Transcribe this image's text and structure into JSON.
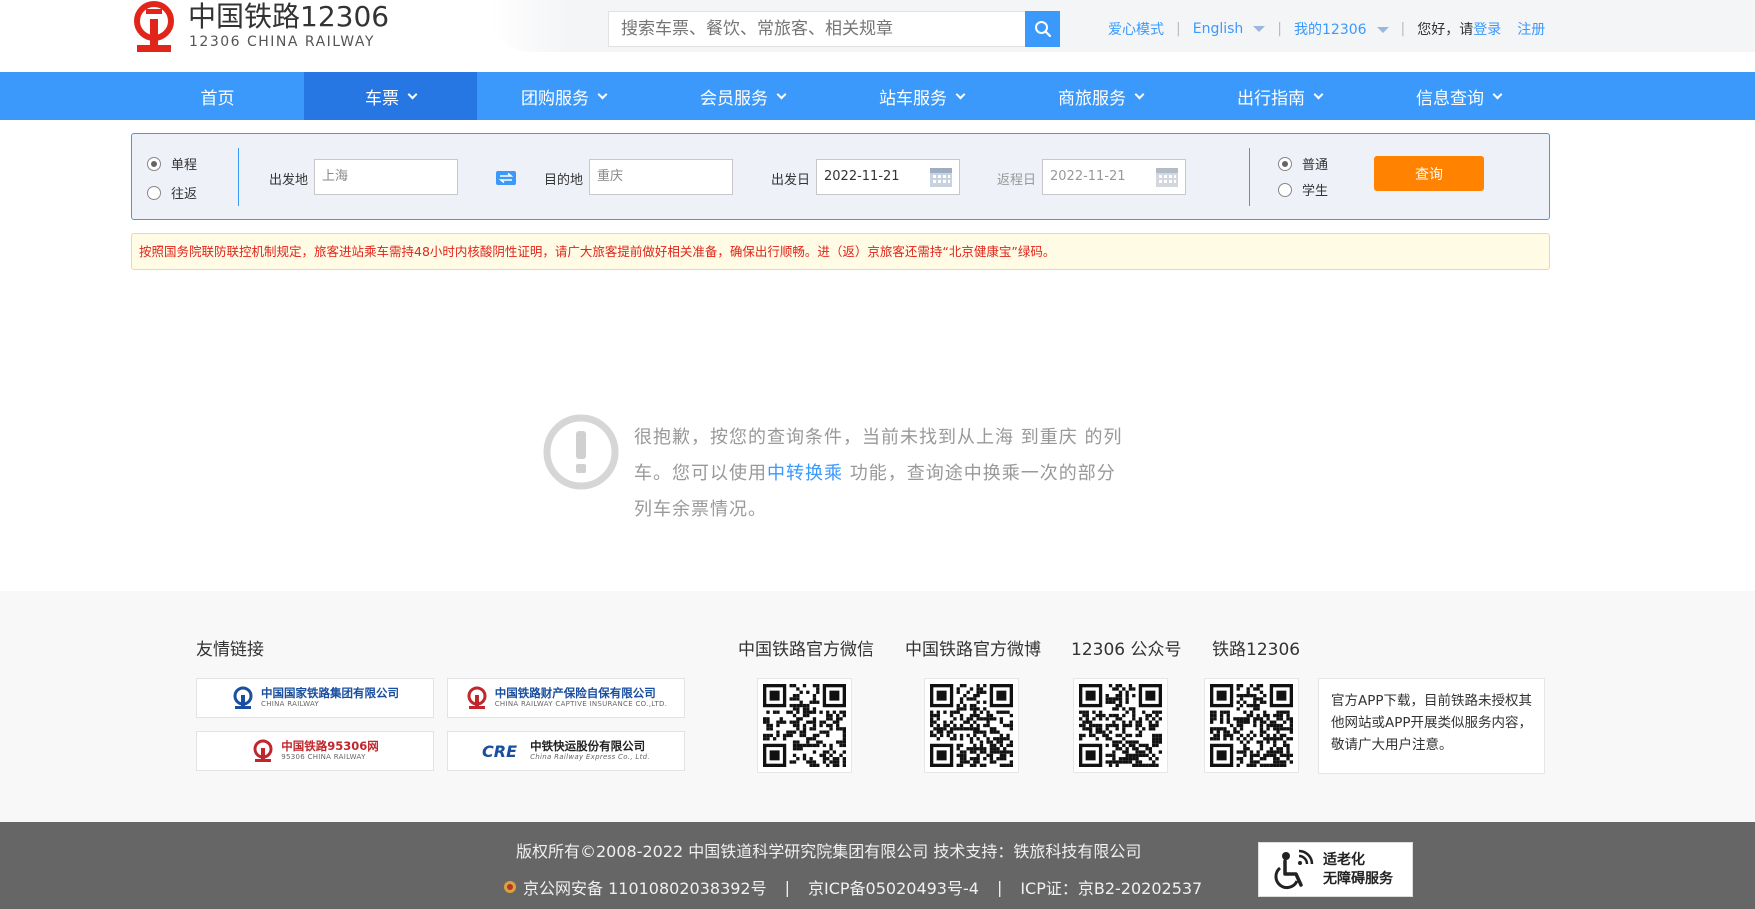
{
  "header": {
    "logo_cn": "中国铁路12306",
    "logo_en": "12306 CHINA RAILWAY",
    "search_placeholder": "搜索车票、餐饮、常旅客、相关规章",
    "links": {
      "care_mode": "爱心模式",
      "english": "English",
      "my12306": "我的12306",
      "greeting": "您好，请",
      "login": "登录",
      "register": "注册"
    }
  },
  "nav": {
    "items": [
      {
        "label": "首页",
        "dropdown": false,
        "active": false
      },
      {
        "label": "车票",
        "dropdown": true,
        "active": true
      },
      {
        "label": "团购服务",
        "dropdown": true,
        "active": false
      },
      {
        "label": "会员服务",
        "dropdown": true,
        "active": false
      },
      {
        "label": "站车服务",
        "dropdown": true,
        "active": false
      },
      {
        "label": "商旅服务",
        "dropdown": true,
        "active": false
      },
      {
        "label": "出行指南",
        "dropdown": true,
        "active": false
      },
      {
        "label": "信息查询",
        "dropdown": true,
        "active": false
      }
    ]
  },
  "query": {
    "trip_type": {
      "one_way": "单程",
      "round_trip": "往返",
      "selected": "one_way"
    },
    "from_label": "出发地",
    "from_value": "上海",
    "to_label": "目的地",
    "to_value": "重庆",
    "depart_label": "出发日",
    "depart_value": "2022-11-21",
    "return_label": "返程日",
    "return_value": "2022-11-21",
    "passenger": {
      "normal": "普通",
      "student": "学生",
      "selected": "normal"
    },
    "search_button": "查询"
  },
  "notice": "按照国务院联防联控机制规定，旅客进站乘车需持48小时内核酸阴性证明，请广大旅客提前做好相关准备，确保出行顺畅。进（返）京旅客还需持“北京健康宝”绿码。",
  "empty": {
    "line1": "很抱歉，按您的查询条件，当前未找到从上海 到重庆 的列",
    "line2_pre": "车。您可以使用",
    "line2_link": "中转换乘",
    "line2_post": " 功能，查询途中换乘一次的部分",
    "line3": "列车余票情况。"
  },
  "footer": {
    "friend_links_title": "友情链接",
    "friend_links": [
      {
        "main": "中国国家铁路集团有限公司",
        "sub": "CHINA RAILWAY"
      },
      {
        "main": "中国铁路财产保险自保有限公司",
        "sub": "CHINA RAILWAY CAPTIVE INSURANCE CO.,LTD."
      },
      {
        "main": "中国铁路95306网",
        "sub": "95306 CHINA RAILWAY"
      },
      {
        "main": "中铁快运股份有限公司",
        "sub": "China Railway Express Co., Ltd."
      }
    ],
    "qr_titles": [
      "中国铁路官方微信",
      "中国铁路官方微博",
      "12306 公众号",
      "铁路12306"
    ],
    "app_note": "官方APP下载，目前铁路未授权其他网站或APP开展类似服务内容，敬请广大用户注意。"
  },
  "bottom": {
    "copyright": "版权所有©2008-2022    中国铁道科学研究院集团有限公司 技术支持：铁旅科技有限公司",
    "police": "京公网安备 11010802038392号",
    "icp": "京ICP备05020493号-4",
    "icp_cert": "ICP证：京B2-20202537",
    "elder_line1": "适老化",
    "elder_line2": "无障碍服务"
  },
  "colors": {
    "primary": "#3b99fc",
    "nav_active": "#2676e3",
    "search_button": "#ff8200",
    "notice_text": "#e1251b",
    "logo_red": "#e1251b"
  }
}
